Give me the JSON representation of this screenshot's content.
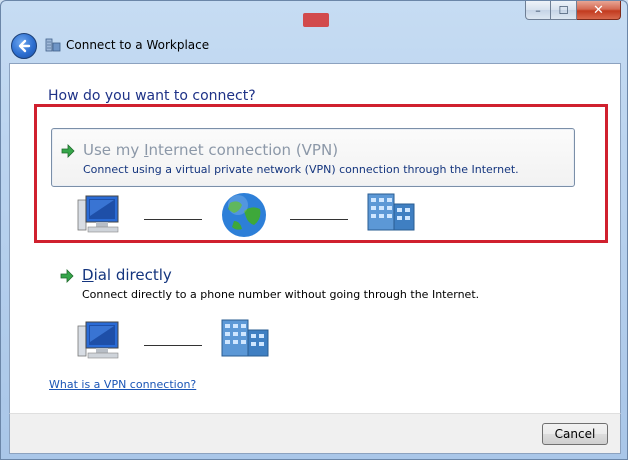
{
  "window": {
    "title": "Connect to a Workplace",
    "caption": {
      "minimize": "–",
      "maximize": "☐",
      "close": "✕"
    }
  },
  "content": {
    "heading": "How do you want to connect?",
    "options": [
      {
        "title_pre": "Use my ",
        "title_accel": "I",
        "title_post": "nternet connection (VPN)",
        "description": "Connect using a virtual private network (VPN) connection through the Internet."
      },
      {
        "title_pre": "",
        "title_accel": "D",
        "title_post": "ial directly",
        "description": "Connect directly to a phone number without going through the Internet."
      }
    ],
    "help_link": "What is a VPN connection?"
  },
  "footer": {
    "cancel_label": "Cancel"
  },
  "colors": {
    "highlight": "#d0202e",
    "heading": "#1e3287",
    "link": "#1a55b6",
    "option_disabled_text": "#8c98a8"
  }
}
